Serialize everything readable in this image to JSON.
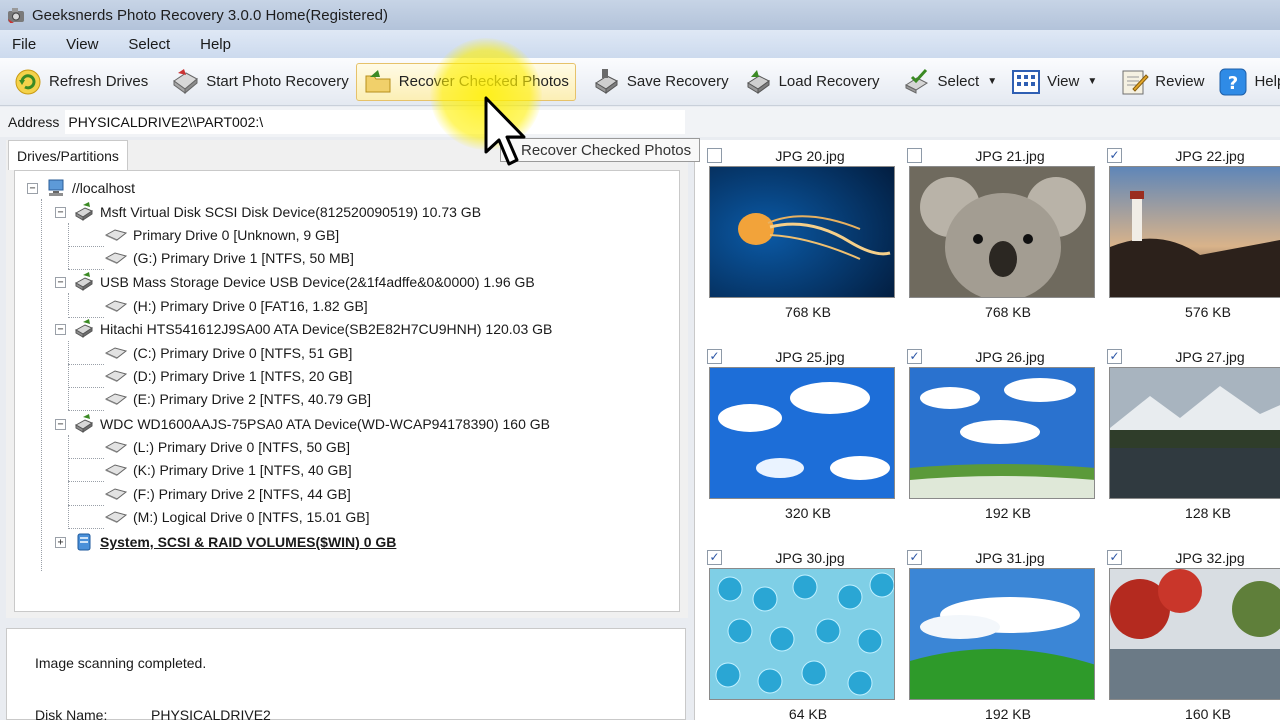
{
  "window": {
    "title": "Geeksnerds Photo Recovery 3.0.0 Home(Registered)"
  },
  "menu": [
    "File",
    "View",
    "Select",
    "Help"
  ],
  "toolbar": {
    "refresh": "Refresh Drives",
    "start": "Start Photo Recovery",
    "recover": "Recover Checked Photos",
    "save": "Save Recovery",
    "load": "Load Recovery",
    "select": "Select",
    "view": "View",
    "review": "Review",
    "help": "Help"
  },
  "address": {
    "label": "Address",
    "value": "PHYSICALDRIVE2\\\\PART002:\\"
  },
  "tooltip": "Recover Checked Photos",
  "tab": "Drives/Partitions",
  "tree": {
    "root": "//localhost",
    "disks": [
      {
        "label": "Msft Virtual Disk SCSI Disk Device(812520090519) 10.73 GB",
        "partitions": [
          "Primary Drive 0 [Unknown, 9 GB]",
          "(G:) Primary Drive 1 [NTFS, 50 MB]"
        ]
      },
      {
        "label": "USB Mass Storage Device USB Device(2&1f4adffe&0&0000) 1.96 GB",
        "partitions": [
          "(H:) Primary Drive 0 [FAT16, 1.82 GB]"
        ]
      },
      {
        "label": "Hitachi HTS541612J9SA00 ATA Device(SB2E82H7CU9HNH) 120.03 GB",
        "partitions": [
          "(C:) Primary Drive 0 [NTFS, 51 GB]",
          "(D:) Primary Drive 1 [NTFS, 20 GB]",
          "(E:) Primary Drive 2 [NTFS, 40.79 GB]"
        ]
      },
      {
        "label": "WDC WD1600AAJS-75PSA0 ATA Device(WD-WCAP94178390) 160 GB",
        "partitions": [
          "(L:) Primary Drive 0 [NTFS, 50 GB]",
          "(K:) Primary Drive 1 [NTFS, 40 GB]",
          "(F:) Primary Drive 2 [NTFS, 44 GB]",
          "(M:) Logical Drive 0 [NTFS, 15.01 GB]"
        ]
      }
    ],
    "system": "System, SCSI & RAID VOLUMES($WIN) 0 GB"
  },
  "status": {
    "message": "Image scanning completed.",
    "disk_label": "Disk Name:",
    "disk_value": "PHYSICALDRIVE2"
  },
  "photos": [
    {
      "name": "JPG 20.jpg",
      "size": "768 KB",
      "checked": false,
      "scene": "jellyfish"
    },
    {
      "name": "JPG 21.jpg",
      "size": "768 KB",
      "checked": false,
      "scene": "koala"
    },
    {
      "name": "JPG 22.jpg",
      "size": "576 KB",
      "checked": true,
      "scene": "lighthouse"
    },
    {
      "name": "JPG 25.jpg",
      "size": "320 KB",
      "checked": true,
      "scene": "sky-clouds"
    },
    {
      "name": "JPG 26.jpg",
      "size": "192 KB",
      "checked": true,
      "scene": "sky-field"
    },
    {
      "name": "JPG 27.jpg",
      "size": "128 KB",
      "checked": true,
      "scene": "mountain-lake"
    },
    {
      "name": "JPG 30.jpg",
      "size": "64 KB",
      "checked": true,
      "scene": "blue-crystals"
    },
    {
      "name": "JPG 31.jpg",
      "size": "192 KB",
      "checked": true,
      "scene": "green-hill"
    },
    {
      "name": "JPG 32.jpg",
      "size": "160 KB",
      "checked": true,
      "scene": "autumn-lake"
    }
  ],
  "colors": {
    "accent": "#f7e600",
    "checkmark": "#2b55a5",
    "toolbar_hot": "#fcefb5"
  }
}
